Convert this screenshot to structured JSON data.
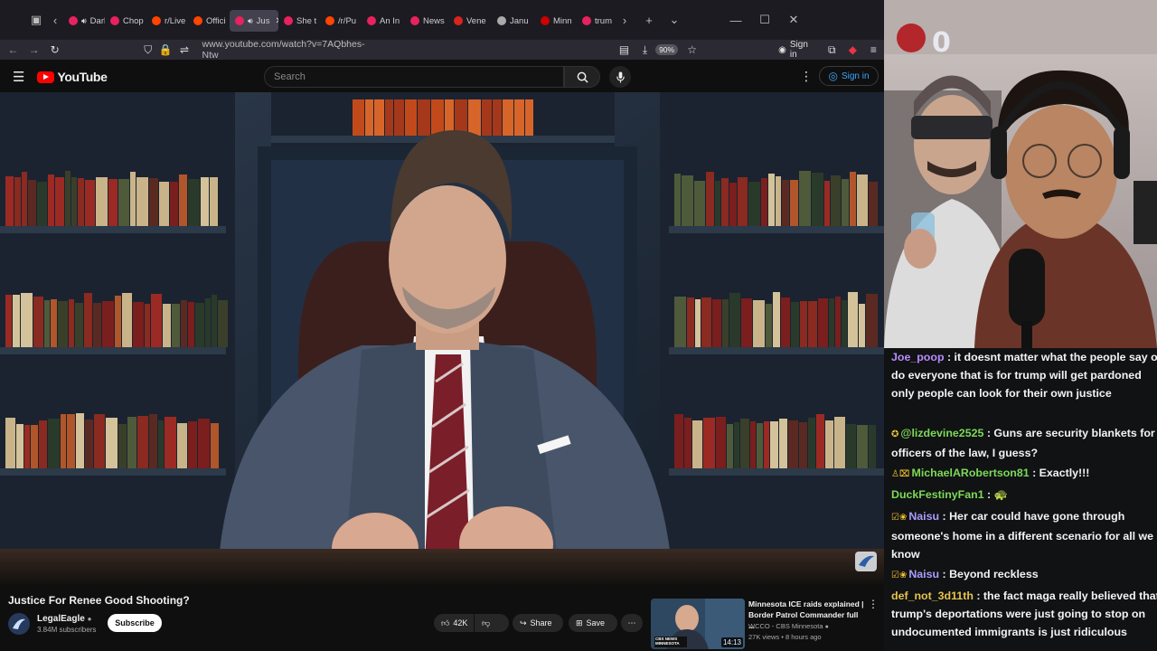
{
  "browser": {
    "tabs": [
      {
        "label": "Dark S",
        "color": "#e8225e",
        "audio": true
      },
      {
        "label": "Chop",
        "color": "#e8225e",
        "audio": false
      },
      {
        "label": "r/Live",
        "color": "#ff4500",
        "audio": false
      },
      {
        "label": "Offici",
        "color": "#ff4500",
        "audio": false
      },
      {
        "label": "Jus",
        "color": "#e8225e",
        "audio": true,
        "active": true
      },
      {
        "label": "She t",
        "color": "#e8225e",
        "audio": false
      },
      {
        "label": "/r/Pu",
        "color": "#ff4500",
        "audio": false
      },
      {
        "label": "An In",
        "color": "#e8225e",
        "audio": false
      },
      {
        "label": "News",
        "color": "#e8225e",
        "audio": false
      },
      {
        "label": "Vene",
        "color": "#d9251c",
        "audio": false
      },
      {
        "label": "Janu",
        "color": "#aaaaaa",
        "audio": false
      },
      {
        "label": "Minn",
        "color": "#cc0000",
        "audio": false
      },
      {
        "label": "trum",
        "color": "#e8225e",
        "audio": false
      }
    ],
    "url": "www.youtube.com/watch?v=7AQbhes-Ntw",
    "zoom": "90%",
    "signin": "Sign in"
  },
  "youtube": {
    "logo": "YouTube",
    "search_placeholder": "Search",
    "signin": "Sign in",
    "video": {
      "title": "Justice For Renee Good Shooting?",
      "channel": "LegalEagle",
      "subscribers": "3.84M subscribers",
      "subscribe": "Subscribe",
      "likes": "42K",
      "share": "Share",
      "save": "Save"
    },
    "recommended": {
      "title": "Minnesota ICE raids explained | Border Patrol Commander full ...",
      "channel": "WCCO - CBS Minnesota",
      "views": "27K views • 8 hours ago",
      "duration": "14:13",
      "thumb_badge": "CBS NEWS MINNESOTA"
    }
  },
  "stream": {
    "overlay_text": "0",
    "chat": [
      {
        "user": "Joe_poop",
        "color": "#b98cff",
        "badge": "",
        "text": "it doesnt matter what the people say or do everyone that is for trump will get pardoned only people can look for their own justice"
      },
      {
        "user": "@lizdevine2525",
        "color": "#7cd957",
        "badge": "✪",
        "text": "Guns are security blankets for officers of the law, I guess?"
      },
      {
        "user": "MichaelARobertson81",
        "color": "#7cd957",
        "badge": "♙⌧",
        "text": "Exactly!!!"
      },
      {
        "user": "DuckFestinyFan1",
        "color": "#7cd957",
        "badge": "",
        "text": "🐢"
      },
      {
        "user": "Naisu",
        "color": "#a99cff",
        "badge": "☑❀",
        "text": "Her car could have gone through someone's home in a different scenario for all we know"
      },
      {
        "user": "Naisu",
        "color": "#a99cff",
        "badge": "☑❀",
        "text": "Beyond reckless"
      },
      {
        "user": "def_not_3d11th",
        "color": "#e6c44a",
        "badge": "",
        "text": "the fact maga really believed that trump's deportations were just going to stop on undocumented immigrants is just ridiculous"
      }
    ]
  }
}
